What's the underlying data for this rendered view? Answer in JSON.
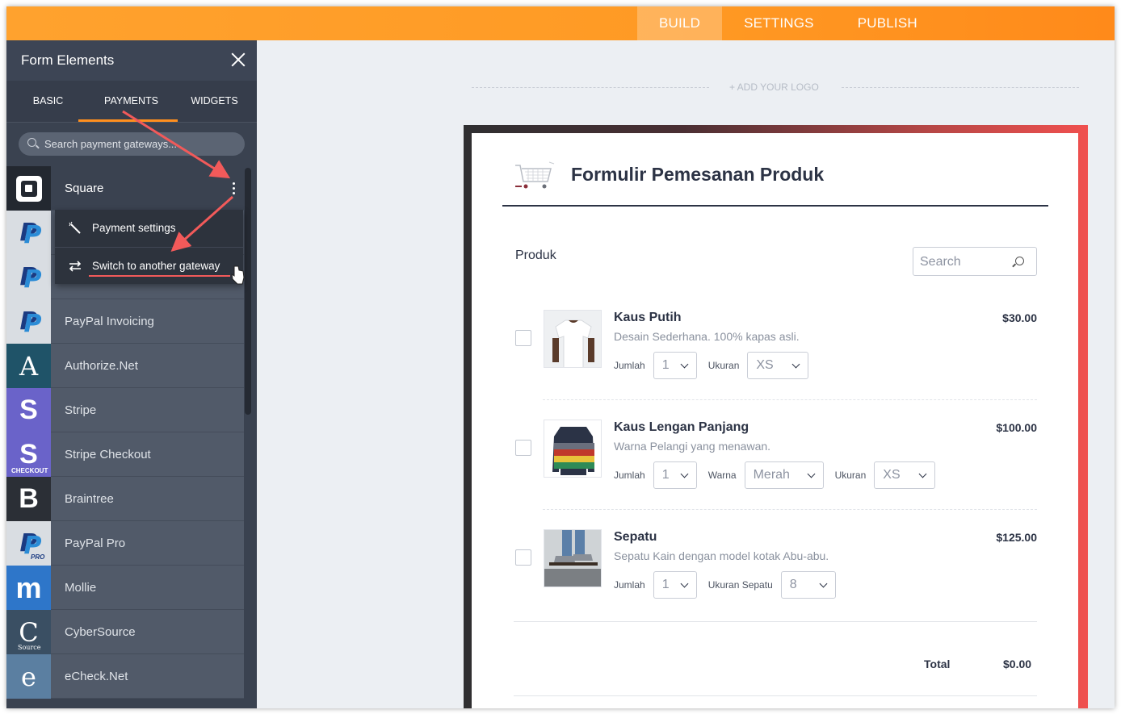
{
  "topnav": {
    "tabs": [
      {
        "label": "BUILD",
        "active": true
      },
      {
        "label": "SETTINGS"
      },
      {
        "label": "PUBLISH"
      }
    ]
  },
  "sidebar": {
    "title": "Form Elements",
    "tabs": [
      {
        "label": "BASIC"
      },
      {
        "label": "PAYMENTS",
        "active": true
      },
      {
        "label": "WIDGETS"
      }
    ],
    "search_placeholder": "Search payment gateways...",
    "gateways": [
      {
        "label": "Square",
        "icon": "square-logo-icon"
      },
      {
        "label": "",
        "icon": "paypal-business-logo-icon"
      },
      {
        "label": "",
        "icon": "paypal-logo-icon"
      },
      {
        "label": "PayPal Invoicing",
        "icon": "paypal-logo-icon"
      },
      {
        "label": "Authorize.Net",
        "icon": "authorize-net-logo-icon"
      },
      {
        "label": "Stripe",
        "icon": "stripe-logo-icon"
      },
      {
        "label": "Stripe Checkout",
        "icon": "stripe-checkout-logo-icon",
        "tag": "CHECKOUT"
      },
      {
        "label": "Braintree",
        "icon": "braintree-logo-icon"
      },
      {
        "label": "PayPal Pro",
        "icon": "paypal-pro-logo-icon",
        "tag": "PRO"
      },
      {
        "label": "Mollie",
        "icon": "mollie-logo-icon"
      },
      {
        "label": "CyberSource",
        "icon": "cybersource-logo-icon",
        "tag": "Source"
      },
      {
        "label": "eCheck.Net",
        "icon": "echeck-logo-icon"
      }
    ],
    "menu": [
      {
        "label": "Payment settings",
        "icon": "magic-wand-icon"
      },
      {
        "label": "Switch to another gateway",
        "icon": "swap-arrows-icon"
      }
    ]
  },
  "canvas": {
    "logo_placeholder": "+ ADD YOUR LOGO"
  },
  "form": {
    "title": "Formulir Pemesanan Produk",
    "section_label": "Produk",
    "search_placeholder": "Search",
    "products": [
      {
        "name": "Kaus Putih",
        "description": "Desain Sederhana. 100% kapas asli.",
        "price": "$30.00",
        "options": [
          {
            "label": "Jumlah",
            "value": "1"
          },
          {
            "label": "Ukuran",
            "value": "XS"
          }
        ]
      },
      {
        "name": "Kaus Lengan Panjang",
        "description": "Warna Pelangi yang menawan.",
        "price": "$100.00",
        "options": [
          {
            "label": "Jumlah",
            "value": "1"
          },
          {
            "label": "Warna",
            "value": "Merah"
          },
          {
            "label": "Ukuran",
            "value": "XS"
          }
        ]
      },
      {
        "name": "Sepatu",
        "description": "Sepatu Kain dengan model kotak Abu-abu.",
        "price": "$125.00",
        "options": [
          {
            "label": "Jumlah",
            "value": "1"
          },
          {
            "label": "Ukuran Sepatu",
            "value": "8"
          }
        ]
      }
    ],
    "total_label": "Total",
    "total_value": "$0.00"
  },
  "colors": {
    "accent": "#ff9a24",
    "annotation": "#f25a5a",
    "sidebar_bg": "#3a4250"
  }
}
